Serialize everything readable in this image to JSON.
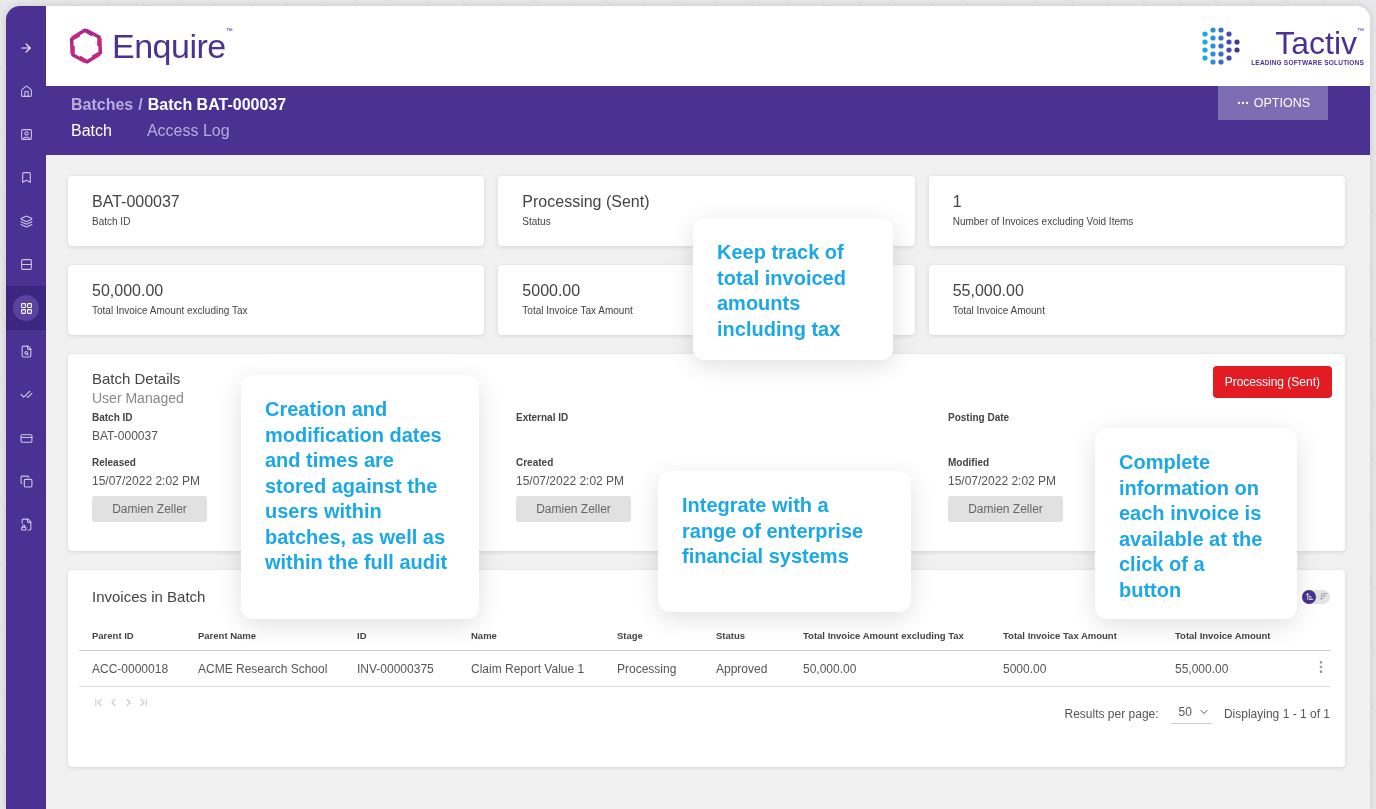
{
  "sidebar": {
    "items": [
      {
        "selected": false
      },
      {
        "selected": false
      },
      {
        "selected": false
      },
      {
        "selected": false
      },
      {
        "selected": false
      },
      {
        "selected": true
      },
      {
        "selected": false
      },
      {
        "selected": false
      },
      {
        "selected": false
      },
      {
        "selected": false
      },
      {
        "selected": false
      }
    ]
  },
  "header": {
    "brand": "Enquire",
    "brand_mark": "™",
    "partner": "Tactiv",
    "partner_mark": "™",
    "partner_tagline": "LEADING SOFTWARE SOLUTIONS"
  },
  "breadcrumb": [
    {
      "label": "Batches",
      "current": false
    },
    {
      "label": "Batch BAT-000037",
      "current": true
    }
  ],
  "breadcrumb_separator": "/",
  "tabs": [
    {
      "label": "Batch",
      "selected": true
    },
    {
      "label": "Access Log",
      "selected": false
    }
  ],
  "options_button": {
    "label": "OPTIONS"
  },
  "stats": [
    {
      "value": "BAT-000037",
      "label": "Batch ID"
    },
    {
      "value": "Processing (Sent)",
      "label": "Status"
    },
    {
      "value": "1",
      "label": "Number of Invoices excluding Void Items"
    },
    {
      "value": "50,000.00",
      "label": "Total Invoice Amount excluding Tax"
    },
    {
      "value": "5000.00",
      "label": "Total Invoice Tax Amount"
    },
    {
      "value": "55,000.00",
      "label": "Total Invoice Amount"
    }
  ],
  "batch_details": {
    "title": "Batch Details",
    "subtitle": "User Managed",
    "status_badge": "Processing (Sent)",
    "fields": [
      {
        "label": "Batch ID",
        "value": "BAT-000037"
      },
      {
        "label": "External ID"
      },
      {
        "label": "Posting Date"
      },
      {
        "label": "Released",
        "value": "15/07/2022 2:02 PM",
        "user": "Damien Zeller"
      },
      {
        "label": "Created",
        "value": "15/07/2022 2:02 PM",
        "user": "Damien Zeller"
      },
      {
        "label": "Modified",
        "value": "15/07/2022 2:02 PM",
        "user": "Damien Zeller"
      }
    ]
  },
  "invoices": {
    "title": "Invoices in Batch",
    "view_toggle": [
      {
        "selected": true
      },
      {
        "selected": false
      }
    ],
    "columns": [
      "Parent ID",
      "Parent Name",
      "ID",
      "Name",
      "Stage",
      "Status",
      "Total Invoice Amount excluding Tax",
      "Total Invoice Tax Amount",
      "Total Invoice Amount"
    ],
    "rows": [
      {
        "cells": [
          "ACC-0000018",
          "ACME Research School",
          "INV-00000375",
          "Claim Report Value 1",
          "Processing",
          "Approved",
          "50,000.00",
          "5000.00",
          "55,000.00"
        ]
      }
    ],
    "pager": {
      "disabled": true
    },
    "results_label": "Results per page:",
    "page_size": "50",
    "displaying": "Displaying 1 - 1 of 1"
  },
  "callouts": [
    {
      "text": "Keep track of total invoiced amounts including tax"
    },
    {
      "text": "Creation and modification dates and times are stored against the users within batches, as well as within the full audit"
    },
    {
      "text": "Integrate with a range of enterprise financial systems"
    },
    {
      "text": "Complete information on each invoice is available at the click of a button"
    }
  ]
}
